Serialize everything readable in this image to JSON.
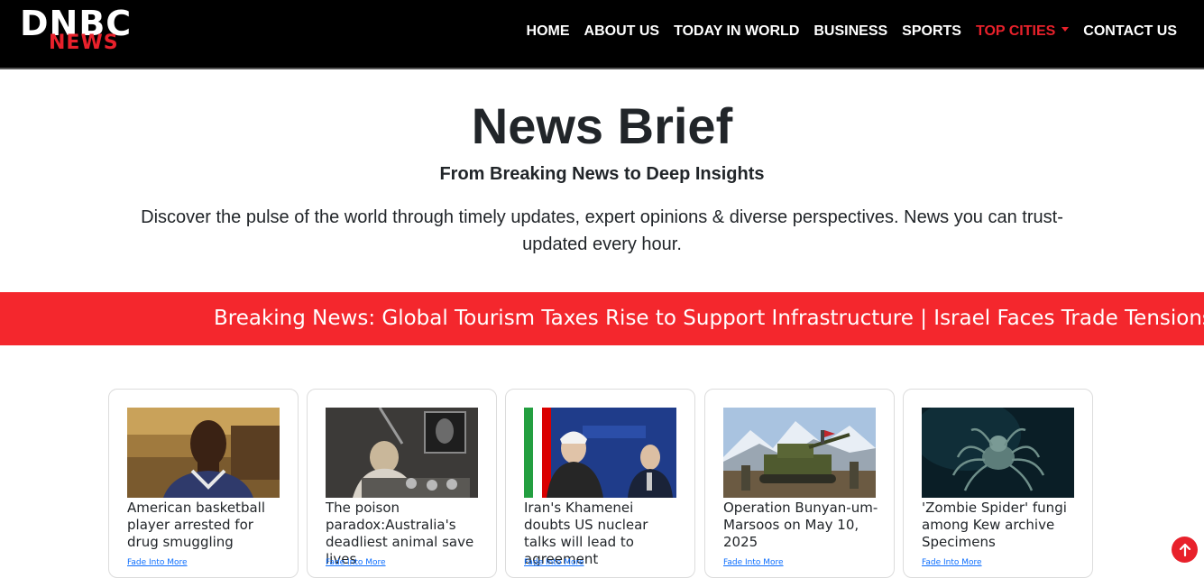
{
  "logo": {
    "line1": "DNBC",
    "line2": "NEWS"
  },
  "nav": {
    "items": [
      {
        "label": "HOME"
      },
      {
        "label": "ABOUT US"
      },
      {
        "label": "TODAY IN WORLD"
      },
      {
        "label": "BUSINESS"
      },
      {
        "label": "SPORTS"
      },
      {
        "label": "TOP CITIES"
      },
      {
        "label": "CONTACT US"
      }
    ],
    "active_label": "TOP CITIES"
  },
  "hero": {
    "title": "News Brief",
    "subtitle": "From Breaking News to Deep Insights",
    "description": "Discover the pulse of the world through timely updates, expert opinions & diverse perspectives. News you can trust- updated every hour."
  },
  "ticker": {
    "text": "Breaking News: Global Tourism Taxes Rise to Support Infrastructure | Israel Faces Trade Tensions Amid"
  },
  "cards": [
    {
      "title": "American basketball player arrested for drug smuggling",
      "link": "Fade Into More",
      "image": "basketball-player-photo"
    },
    {
      "title": "The poison paradox:Australia's deadliest animal save lives",
      "link": "Fade Into More",
      "image": "lab-researcher-photo"
    },
    {
      "title": "Iran's Khamenei doubts US nuclear talks will lead to agreement",
      "link": "Fade Into More",
      "image": "diplomatic-meeting-photo"
    },
    {
      "title": "Operation Bunyan-um-Marsoos on May 10, 2025",
      "link": "Fade Into More",
      "image": "tank-soldiers-photo"
    },
    {
      "title": "'Zombie Spider' fungi among Kew archive Specimens",
      "link": "Fade Into More",
      "image": "spider-photo"
    }
  ],
  "colors": {
    "brand_red": "#e8212b",
    "ticker_bg": "#f4272d",
    "navbar_bg": "#000000",
    "link_blue": "#0d6efd"
  },
  "scroll_top_icon": "arrow-up-icon"
}
